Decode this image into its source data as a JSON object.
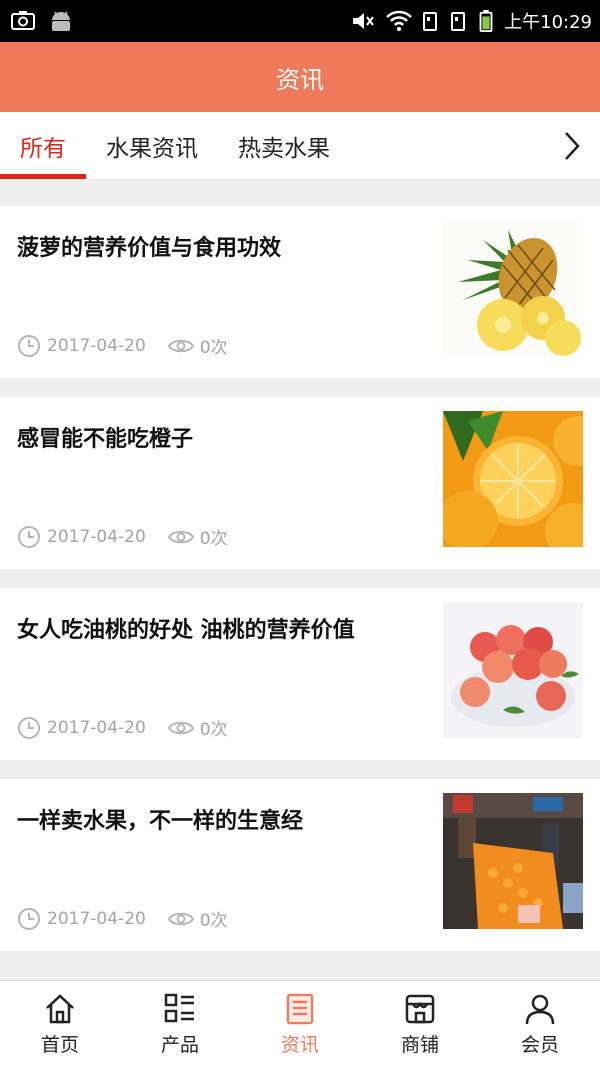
{
  "status_bar": {
    "time": "上午10:29"
  },
  "header": {
    "title": "资讯"
  },
  "tabs": [
    {
      "label": "所有",
      "active": true
    },
    {
      "label": "水果资讯",
      "active": false
    },
    {
      "label": "热卖水果",
      "active": false
    }
  ],
  "articles": [
    {
      "title": "菠萝的营养价值与食用功效",
      "date": "2017-04-20",
      "views": "0次",
      "image": "pineapple"
    },
    {
      "title": "感冒能不能吃橙子",
      "date": "2017-04-20",
      "views": "0次",
      "image": "oranges"
    },
    {
      "title": "女人吃油桃的好处 油桃的营养价值",
      "date": "2017-04-20",
      "views": "0次",
      "image": "nectarines"
    },
    {
      "title": "一样卖水果，不一样的生意经",
      "date": "2017-04-20",
      "views": "0次",
      "image": "fruit-market"
    }
  ],
  "bottom_nav": [
    {
      "label": "首页",
      "icon": "home-icon",
      "active": false
    },
    {
      "label": "产品",
      "icon": "grid-list-icon",
      "active": false
    },
    {
      "label": "资讯",
      "icon": "document-icon",
      "active": true
    },
    {
      "label": "商铺",
      "icon": "shop-icon",
      "active": false
    },
    {
      "label": "会员",
      "icon": "user-icon",
      "active": false
    }
  ],
  "colors": {
    "accent": "#ef7a5b",
    "tab_active": "#d9291c",
    "meta": "#a4a4a4"
  }
}
